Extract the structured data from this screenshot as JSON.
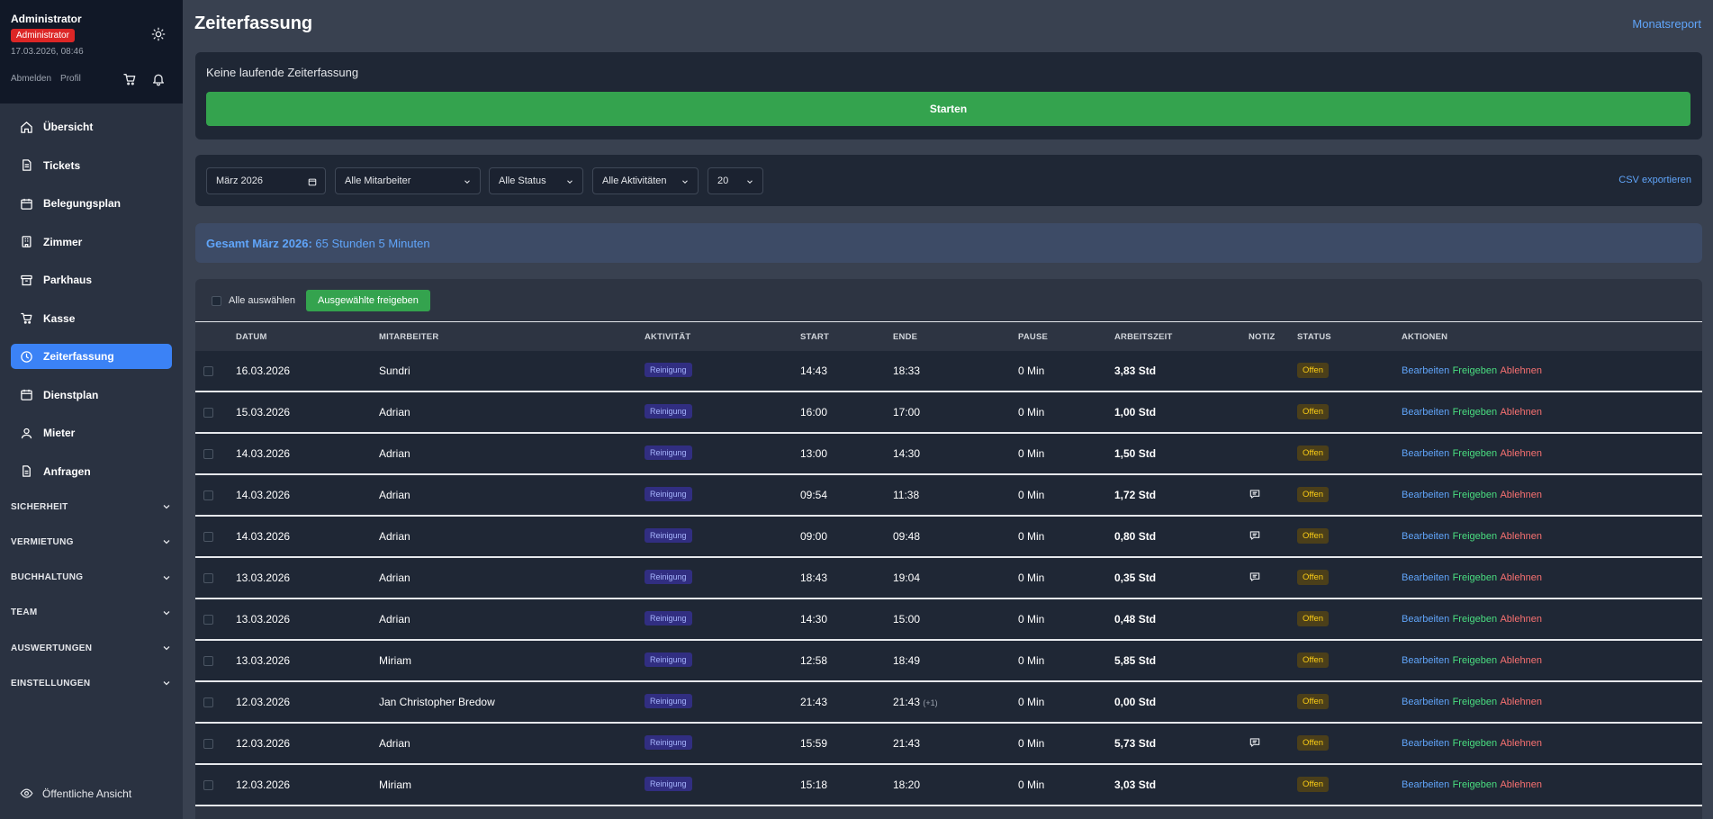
{
  "user": {
    "name": "Administrator",
    "role_badge": "Administrator",
    "datetime": "17.03.2026, 08:46",
    "logout": "Abmelden",
    "profile": "Profil"
  },
  "nav": {
    "items": [
      {
        "label": "Übersicht",
        "icon": "home-icon"
      },
      {
        "label": "Tickets",
        "icon": "ticket-icon"
      },
      {
        "label": "Belegungsplan",
        "icon": "calendar-icon"
      },
      {
        "label": "Zimmer",
        "icon": "building-icon"
      },
      {
        "label": "Parkhaus",
        "icon": "archive-icon"
      },
      {
        "label": "Kasse",
        "icon": "cart-icon"
      },
      {
        "label": "Zeiterfassung",
        "icon": "clock-icon",
        "active": true
      },
      {
        "label": "Dienstplan",
        "icon": "calendar-icon"
      },
      {
        "label": "Mieter",
        "icon": "users-icon"
      },
      {
        "label": "Anfragen",
        "icon": "document-icon"
      }
    ],
    "sections": [
      "SICHERHEIT",
      "VERMIETUNG",
      "BUCHHALTUNG",
      "TEAM",
      "AUSWERTUNGEN",
      "EINSTELLUNGEN"
    ],
    "public_view": "Öffentliche Ansicht"
  },
  "page": {
    "title": "Zeiterfassung",
    "monthly_report": "Monatsreport"
  },
  "tracker": {
    "message": "Keine laufende Zeiterfassung",
    "start_label": "Starten"
  },
  "filters": {
    "month": "März 2026",
    "employee": "Alle Mitarbeiter",
    "status": "Alle Status",
    "activity": "Alle Aktivitäten",
    "page_size": "20",
    "csv": "CSV exportieren"
  },
  "total": {
    "label": "Gesamt März 2026:",
    "value": "65 Stunden 5 Minuten"
  },
  "bulk": {
    "select_all": "Alle auswählen",
    "approve_selected": "Ausgewählte freigeben"
  },
  "table": {
    "headers": [
      "DATUM",
      "MITARBEITER",
      "AKTIVITÄT",
      "START",
      "ENDE",
      "PAUSE",
      "ARBEITSZEIT",
      "NOTIZ",
      "STATUS",
      "AKTIONEN"
    ],
    "actions": {
      "edit": "Bearbeiten",
      "approve": "Freigeben",
      "reject": "Ablehnen"
    },
    "rows": [
      {
        "date": "16.03.2026",
        "employee": "Sundri",
        "activity": "Reinigung",
        "start": "14:43",
        "end": "18:33",
        "end_suffix": "",
        "pause": "0 Min",
        "hours": "3,83 Std",
        "note": false,
        "status": "Offen"
      },
      {
        "date": "15.03.2026",
        "employee": "Adrian",
        "activity": "Reinigung",
        "start": "16:00",
        "end": "17:00",
        "end_suffix": "",
        "pause": "0 Min",
        "hours": "1,00 Std",
        "note": false,
        "status": "Offen"
      },
      {
        "date": "14.03.2026",
        "employee": "Adrian",
        "activity": "Reinigung",
        "start": "13:00",
        "end": "14:30",
        "end_suffix": "",
        "pause": "0 Min",
        "hours": "1,50 Std",
        "note": false,
        "status": "Offen"
      },
      {
        "date": "14.03.2026",
        "employee": "Adrian",
        "activity": "Reinigung",
        "start": "09:54",
        "end": "11:38",
        "end_suffix": "",
        "pause": "0 Min",
        "hours": "1,72 Std",
        "note": true,
        "status": "Offen"
      },
      {
        "date": "14.03.2026",
        "employee": "Adrian",
        "activity": "Reinigung",
        "start": "09:00",
        "end": "09:48",
        "end_suffix": "",
        "pause": "0 Min",
        "hours": "0,80 Std",
        "note": true,
        "status": "Offen"
      },
      {
        "date": "13.03.2026",
        "employee": "Adrian",
        "activity": "Reinigung",
        "start": "18:43",
        "end": "19:04",
        "end_suffix": "",
        "pause": "0 Min",
        "hours": "0,35 Std",
        "note": true,
        "status": "Offen"
      },
      {
        "date": "13.03.2026",
        "employee": "Adrian",
        "activity": "Reinigung",
        "start": "14:30",
        "end": "15:00",
        "end_suffix": "",
        "pause": "0 Min",
        "hours": "0,48 Std",
        "note": false,
        "status": "Offen"
      },
      {
        "date": "13.03.2026",
        "employee": "Miriam",
        "activity": "Reinigung",
        "start": "12:58",
        "end": "18:49",
        "end_suffix": "",
        "pause": "0 Min",
        "hours": "5,85 Std",
        "note": false,
        "status": "Offen"
      },
      {
        "date": "12.03.2026",
        "employee": "Jan Christopher Bredow",
        "activity": "Reinigung",
        "start": "21:43",
        "end": "21:43",
        "end_suffix": "(+1)",
        "pause": "0 Min",
        "hours": "0,00 Std",
        "note": false,
        "status": "Offen"
      },
      {
        "date": "12.03.2026",
        "employee": "Adrian",
        "activity": "Reinigung",
        "start": "15:59",
        "end": "21:43",
        "end_suffix": "",
        "pause": "0 Min",
        "hours": "5,73 Std",
        "note": true,
        "status": "Offen"
      },
      {
        "date": "12.03.2026",
        "employee": "Miriam",
        "activity": "Reinigung",
        "start": "15:18",
        "end": "18:20",
        "end_suffix": "",
        "pause": "0 Min",
        "hours": "3,03 Std",
        "note": false,
        "status": "Offen"
      }
    ]
  }
}
